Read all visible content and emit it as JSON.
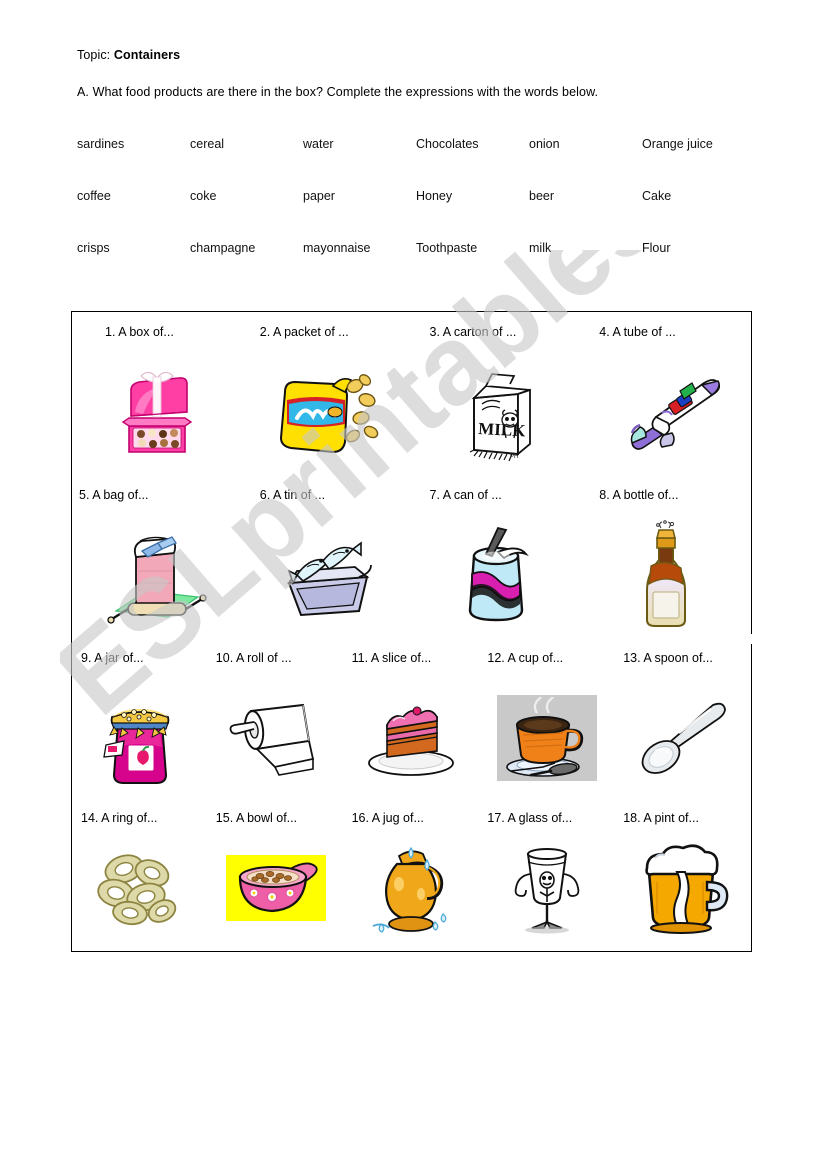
{
  "header": {
    "topic_label": "Topic:",
    "topic_value": "Containers",
    "instruction": "A. What food products are there in the box? Complete the expressions with the words below."
  },
  "word_bank": {
    "rows": [
      [
        "sardines",
        "cereal",
        "water",
        "Chocolates",
        "onion",
        "Orange juice"
      ],
      [
        "coffee",
        "coke",
        "paper",
        "Honey",
        "beer",
        "Cake"
      ],
      [
        "crisps",
        "champagne",
        "mayonnaise",
        "Toothpaste",
        "milk",
        "Flour"
      ]
    ]
  },
  "exercise": {
    "rows": [
      [
        {
          "label": "1.  A box of...",
          "icon": "chocolate-box-icon"
        },
        {
          "label": "2. A packet of ...",
          "icon": "crisps-packet-icon"
        },
        {
          "label": "3. A carton of ...",
          "icon": "milk-carton-icon"
        },
        {
          "label": "4. A tube of ...",
          "icon": "toothpaste-tube-icon"
        }
      ],
      [
        {
          "label": "5. A bag of...",
          "icon": "flour-bag-icon"
        },
        {
          "label": "6. A tin of ...",
          "icon": "sardine-tin-icon"
        },
        {
          "label": "7. A can of ...",
          "icon": "soda-can-icon"
        },
        {
          "label": "8. A bottle of...",
          "icon": "bottle-icon"
        }
      ],
      [
        {
          "label": "9. A jar of...",
          "icon": "jam-jar-icon"
        },
        {
          "label": "10. A roll of ...",
          "icon": "paper-roll-icon"
        },
        {
          "label": "11. A slice of...",
          "icon": "cake-slice-icon"
        },
        {
          "label": "12. A cup of...",
          "icon": "coffee-cup-icon"
        },
        {
          "label": "13. A spoon of...",
          "icon": "spoon-icon"
        }
      ],
      [
        {
          "label": "14. A ring of...",
          "icon": "onion-rings-icon"
        },
        {
          "label": "15. A bowl of...",
          "icon": "cereal-bowl-icon"
        },
        {
          "label": "16. A jug of...",
          "icon": "juice-jug-icon"
        },
        {
          "label": "17. A glass of...",
          "icon": "water-glass-icon"
        },
        {
          "label": "18. A pint of...",
          "icon": "beer-mug-icon"
        }
      ]
    ]
  },
  "watermark": {
    "text": "ESLprintables.com",
    "color": "#c8c8c8"
  }
}
